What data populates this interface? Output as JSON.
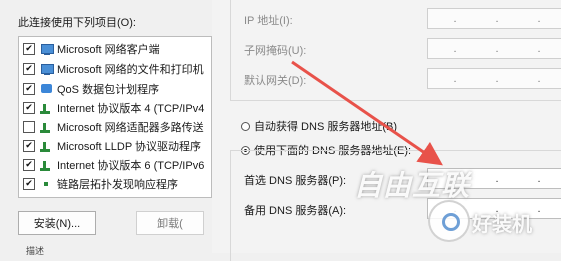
{
  "left": {
    "conn_label": "此连接使用下列项目(O):",
    "items": [
      {
        "label": "Microsoft 网络客户端",
        "checked": true,
        "icon": "computer-icon"
      },
      {
        "label": "Microsoft 网络的文件和打印机",
        "checked": true,
        "icon": "computer-icon"
      },
      {
        "label": "QoS 数据包计划程序",
        "checked": true,
        "icon": "qos-icon"
      },
      {
        "label": "Internet 协议版本 4 (TCP/IPv4",
        "checked": true,
        "icon": "network-protocol-icon"
      },
      {
        "label": "Microsoft 网络适配器多路传送",
        "checked": false,
        "icon": "network-protocol-icon"
      },
      {
        "label": "Microsoft LLDP 协议驱动程序",
        "checked": true,
        "icon": "network-protocol-icon"
      },
      {
        "label": "Internet 协议版本 6 (TCP/IPv6",
        "checked": true,
        "icon": "network-protocol-icon"
      },
      {
        "label": "链路层拓扑发现响应程序",
        "checked": true,
        "icon": "network-protocol-icon"
      }
    ],
    "install_label": "安装(N)...",
    "uninstall_label": "卸载(",
    "bottom_label": "描述"
  },
  "right": {
    "ip_fields": [
      {
        "label": "IP 地址(I):",
        "value": ".     .     ."
      },
      {
        "label": "子网掩码(U):",
        "value": ".     .     ."
      },
      {
        "label": "默认网关(D):",
        "value": ".     .     ."
      }
    ],
    "radio_auto": "自动获得 DNS 服务器地址(B)",
    "radio_manual": "使用下面的 DNS 服务器地址(E):",
    "preferred_dns_label": "首选 DNS 服务器(P):",
    "alternate_dns_label": "备用 DNS 服务器(A):"
  },
  "watermark": {
    "main": "自由互联",
    "sub": "好装机"
  },
  "colors": {
    "arrow": "#e8524a"
  }
}
